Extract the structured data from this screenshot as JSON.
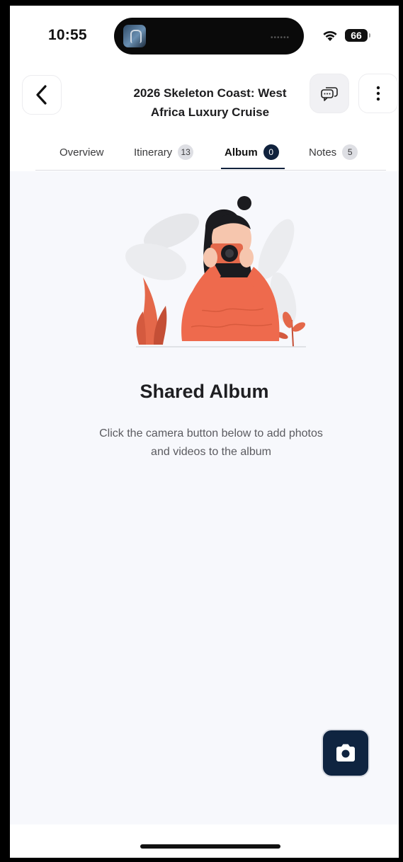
{
  "status_bar": {
    "time": "10:55",
    "battery": "66"
  },
  "header": {
    "title_line1": "2026 Skeleton Coast: West",
    "title_line2": "Africa Luxury Cruise"
  },
  "tabs": [
    {
      "label": "Overview",
      "badge": ""
    },
    {
      "label": "Itinerary",
      "badge": "13"
    },
    {
      "label": "Album",
      "badge": "0",
      "active": true
    },
    {
      "label": "Notes",
      "badge": "5"
    }
  ],
  "empty_state": {
    "title": "Shared Album",
    "description": "Click the camera button below to add photos and videos to the album"
  },
  "colors": {
    "accent": "#10223d",
    "background": "#f7f8fc",
    "illustration_accent": "#ee6a4d"
  },
  "icons": [
    "back-chevron-icon",
    "chat-icon",
    "more-vertical-icon",
    "camera-icon",
    "wifi-icon"
  ]
}
